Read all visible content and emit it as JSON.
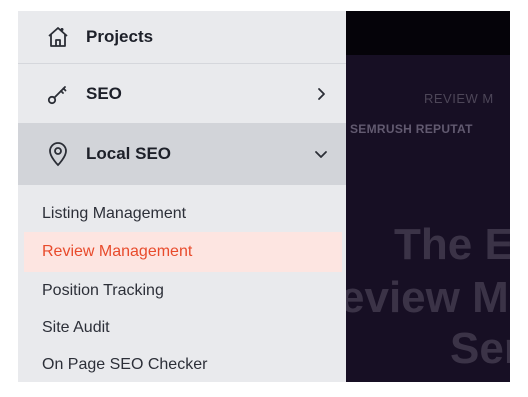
{
  "sidebar": {
    "projects": {
      "label": "Projects",
      "icon": "home-icon"
    },
    "seo": {
      "label": "SEO",
      "icon": "key-icon",
      "chevron": "chevron-right-icon"
    },
    "local_seo": {
      "label": "Local SEO",
      "icon": "location-pin-icon",
      "chevron": "chevron-down-icon",
      "expanded": true
    },
    "sub_items": [
      {
        "label": "Listing Management",
        "active": false
      },
      {
        "label": "Review Management",
        "active": true
      },
      {
        "label": "Position Tracking",
        "active": false
      },
      {
        "label": "Site Audit",
        "active": false
      },
      {
        "label": "On Page SEO Checker",
        "active": false
      }
    ]
  },
  "preview": {
    "eyebrow": "REVIEW M",
    "small_caption": "SEMRUSH REPUTAT",
    "headline_lines": [
      "The Ea",
      "eview Ma",
      "Ser"
    ]
  },
  "colors": {
    "sidebar_bg": "#e9eaed",
    "expanded_bg": "#d2d4d9",
    "active_bg": "#fde5e1",
    "active_text": "#e84b2c",
    "preview_bg": "#170f24"
  }
}
